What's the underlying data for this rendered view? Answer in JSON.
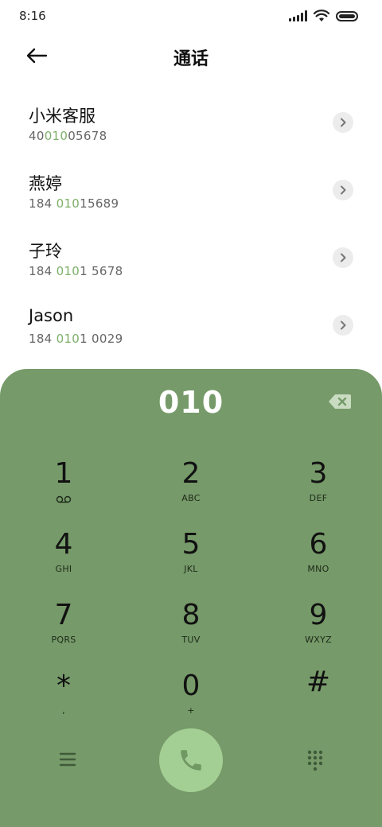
{
  "status": {
    "time": "8:16"
  },
  "header": {
    "title": "通话"
  },
  "contacts": [
    {
      "name": "小米客服",
      "number_pre": "40",
      "number_match": "010",
      "number_post": "05678"
    },
    {
      "name": "燕婷",
      "number_pre": "184 ",
      "number_match": "010",
      "number_post": "15689"
    },
    {
      "name": "子玲",
      "number_pre": "184 ",
      "number_match": "010",
      "number_post": "1 5678"
    },
    {
      "name": "Jason",
      "number_pre": "184 ",
      "number_match": "010",
      "number_post": "1 0029"
    }
  ],
  "dialpad": {
    "display": "010",
    "keys": [
      {
        "digit": "1",
        "letters": ""
      },
      {
        "digit": "2",
        "letters": "ABC"
      },
      {
        "digit": "3",
        "letters": "DEF"
      },
      {
        "digit": "4",
        "letters": "GHI"
      },
      {
        "digit": "5",
        "letters": "JKL"
      },
      {
        "digit": "6",
        "letters": "MNO"
      },
      {
        "digit": "7",
        "letters": "PQRS"
      },
      {
        "digit": "8",
        "letters": "TUV"
      },
      {
        "digit": "9",
        "letters": "WXYZ"
      },
      {
        "digit": "*",
        "letters": ","
      },
      {
        "digit": "0",
        "letters": "+"
      },
      {
        "digit": "#",
        "letters": ""
      }
    ]
  },
  "colors": {
    "pad_bg": "#769a69",
    "call_btn": "#a4cf94",
    "highlight": "#7fb069"
  },
  "icons": [
    "back-arrow-icon",
    "signal-icon",
    "wifi-icon",
    "battery-icon",
    "chevron-right-icon",
    "backspace-icon",
    "voicemail-icon",
    "menu-icon",
    "phone-icon",
    "dialpad-icon"
  ]
}
